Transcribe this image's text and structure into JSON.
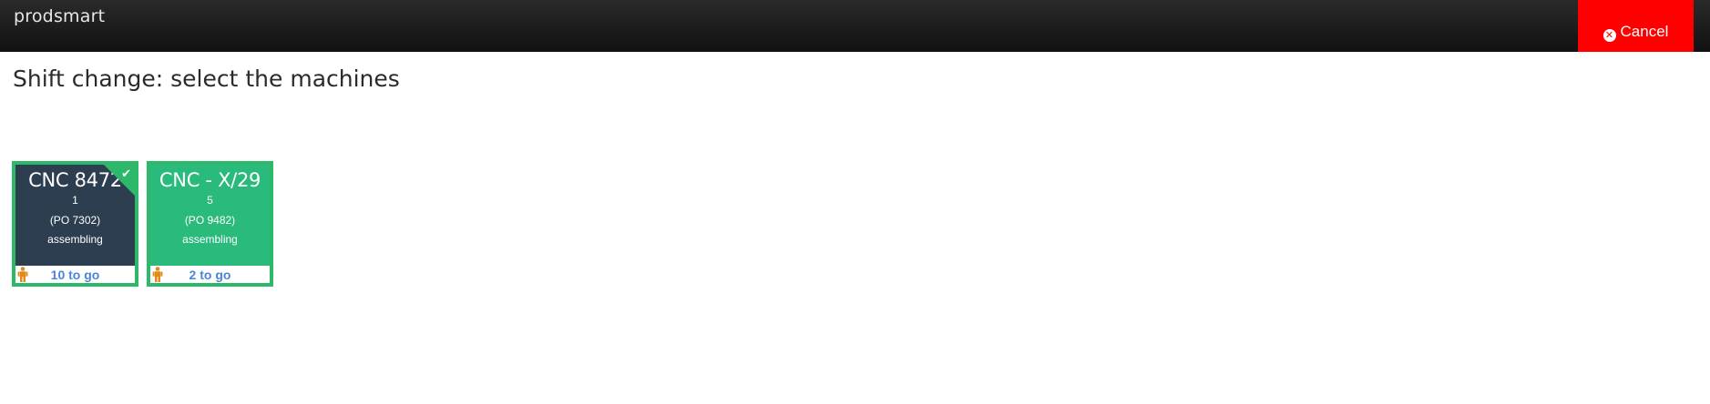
{
  "header": {
    "brand": "prodsmart",
    "cancel_label": "Cancel",
    "cancel_icon": "times-circle-icon"
  },
  "page": {
    "title": "Shift change: select the machines"
  },
  "machines": [
    {
      "name": "CNC 8472",
      "quantity": "1",
      "po": "(PO 7302)",
      "stage": "assembling",
      "to_go": "10 to go",
      "selected": true,
      "color": "#2d3e50"
    },
    {
      "name": "CNC - X/29",
      "quantity": "5",
      "po": "(PO 9482)",
      "stage": "assembling",
      "to_go": "2 to go",
      "selected": false,
      "color": "#2aba7b"
    }
  ],
  "colors": {
    "accent_green": "#2eb86a",
    "cancel_red": "#ff0000",
    "togo_blue": "#4a86d8",
    "person_orange": "#e08a1e"
  }
}
